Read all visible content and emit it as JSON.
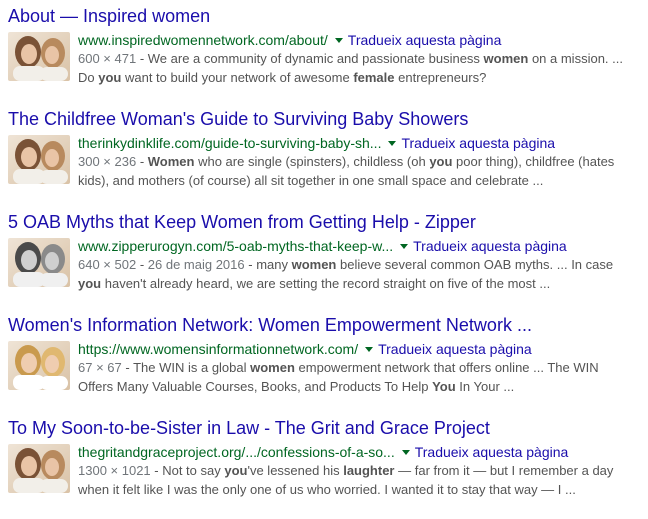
{
  "translate_label": "Tradueix aquesta pàgina",
  "results": [
    {
      "title": "About — Inspired women",
      "url": "www.inspiredwomennetwork.com/about/",
      "dims": "600 × 471",
      "thumb": "color",
      "lines": [
        [
          {
            "t": "We are a community of dynamic and passionate business "
          },
          {
            "t": "women",
            "b": true
          },
          {
            "t": " on a mission. ..."
          }
        ],
        [
          {
            "t": "Do "
          },
          {
            "t": "you",
            "b": true
          },
          {
            "t": " want to build your network of awesome "
          },
          {
            "t": "female",
            "b": true
          },
          {
            "t": " entrepreneurs?"
          }
        ]
      ]
    },
    {
      "title": "The Childfree Woman's Guide to Surviving Baby Showers",
      "url": "therinkydinklife.com/guide-to-surviving-baby-sh...",
      "dims": "300 × 236",
      "thumb": "color",
      "lines": [
        [
          {
            "t": "Women",
            "b": true
          },
          {
            "t": " who are single (spinsters), childless (oh "
          },
          {
            "t": "you",
            "b": true
          },
          {
            "t": " poor thing), childfree (hates"
          }
        ],
        [
          {
            "t": "kids), and mothers (of course) all sit together in one small space and celebrate ..."
          }
        ]
      ]
    },
    {
      "title": "5 OAB Myths that Keep Women from Getting Help - Zipper",
      "url": "www.zipperurogyn.com/5-oab-myths-that-keep-w...",
      "dims": "640 × 502",
      "date": "26 de maig 2016",
      "thumb": "gray",
      "lines": [
        [
          {
            "t": "many "
          },
          {
            "t": "women",
            "b": true
          },
          {
            "t": " believe several common OAB myths. ... In case"
          }
        ],
        [
          {
            "t": "you",
            "b": true
          },
          {
            "t": " haven't already heard, we are setting the record straight on five of the most ..."
          }
        ]
      ]
    },
    {
      "title": "Women's Information Network: Women Empowerment Network ...",
      "url": "https://www.womensinformationnetwork.com/",
      "dims": "67 × 67",
      "thumb": "blonde",
      "lines": [
        [
          {
            "t": "The WIN is a global "
          },
          {
            "t": "women",
            "b": true
          },
          {
            "t": " empowerment network that offers online ... The WIN"
          }
        ],
        [
          {
            "t": "Offers Many Valuable Courses, Books, and Products To Help "
          },
          {
            "t": "You",
            "b": true
          },
          {
            "t": " In Your ..."
          }
        ]
      ]
    },
    {
      "title": "To My Soon-to-be-Sister in Law - The Grit and Grace Project",
      "url": "thegritandgraceproject.org/.../confessions-of-a-so...",
      "dims": "1300 × 1021",
      "thumb": "color",
      "lines": [
        [
          {
            "t": "Not to say "
          },
          {
            "t": "you",
            "b": true
          },
          {
            "t": "'ve lessened his "
          },
          {
            "t": "laughter",
            "b": true
          },
          {
            "t": " — far from it — but I remember a day"
          }
        ],
        [
          {
            "t": "when it felt like I was the only one of us who worried. I wanted it to stay that way — I ..."
          }
        ]
      ]
    }
  ]
}
